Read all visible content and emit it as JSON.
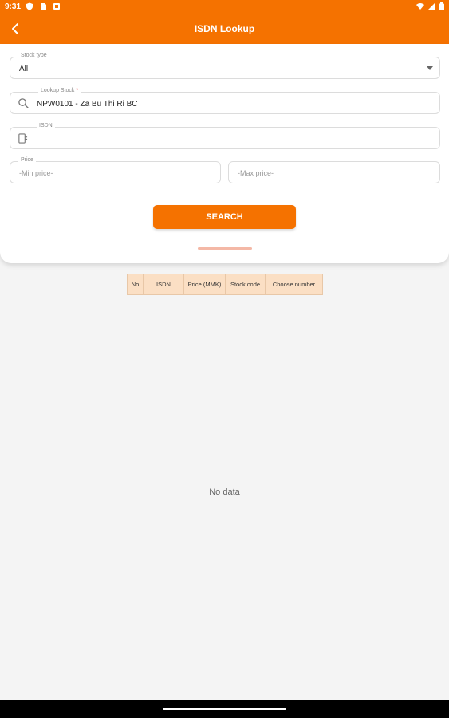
{
  "status_bar": {
    "time": "9:31",
    "left_icons": [
      "shield-icon",
      "sim-card-icon",
      "notification-icon"
    ],
    "right_icons": [
      "wifi-icon",
      "signal-icon",
      "battery-icon"
    ]
  },
  "app_bar": {
    "title": "ISDN Lookup",
    "back_icon": "back-arrow-icon",
    "color": "#f57200"
  },
  "form": {
    "stock_type": {
      "label": "Stock type",
      "value": "All"
    },
    "lookup_stock": {
      "label": "Lookup Stock",
      "required_mark": "*",
      "value": "NPW0101 - Za Bu Thi Ri BC"
    },
    "isdn": {
      "label": "ISDN",
      "value": ""
    },
    "price": {
      "label": "Price",
      "min_placeholder": "-Min price-",
      "max_placeholder": "-Max price-"
    },
    "search_button": "SEARCH"
  },
  "table": {
    "columns": [
      "No",
      "ISDN",
      "Price (MMK)",
      "Stock code",
      "Choose number"
    ],
    "rows": []
  },
  "empty_message": "No data"
}
